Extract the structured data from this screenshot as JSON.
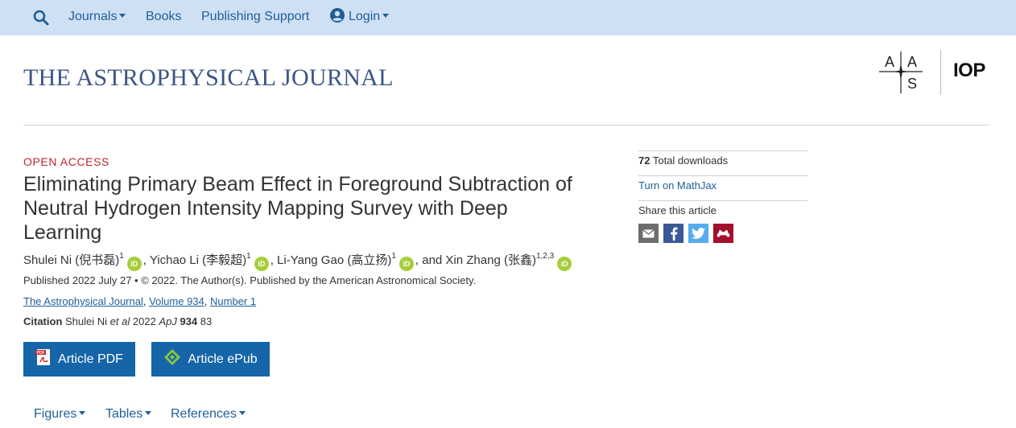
{
  "nav": {
    "journals": "Journals",
    "books": "Books",
    "publishing_support": "Publishing Support",
    "login": "Login"
  },
  "header": {
    "journal_title": "THE ASTROPHYSICAL JOURNAL",
    "aas_letters": [
      "A",
      "A",
      "S"
    ],
    "iop_logo": "IOP"
  },
  "article": {
    "access_label": "OPEN ACCESS",
    "title": "Eliminating Primary Beam Effect in Foreground Subtraction of Neutral Hydrogen Intensity Mapping Survey with Deep Learning",
    "authors": [
      {
        "name": "Shulei Ni (倪书磊)",
        "aff": "1"
      },
      {
        "name": "Yichao Li (李毅超)",
        "aff": "1"
      },
      {
        "name": "Li-Yang Gao (高立扬)",
        "aff": "1"
      },
      {
        "name": "Xin Zhang (张鑫)",
        "aff": "1,2,3"
      }
    ],
    "author_sep": ", ",
    "author_last_sep": ", and ",
    "orcid_label": "iD",
    "published": "Published 2022 July 27 • © 2022. The Author(s). Published by the American Astronomical Society.",
    "journal_link": "The Astrophysical Journal",
    "volume_link": "Volume 934",
    "number_link": "Number 1",
    "link_sep": ", ",
    "citation": {
      "label": "Citation",
      "author": "Shulei Ni",
      "etal": "et al",
      "year": "2022",
      "journal": "ApJ",
      "volume": "934",
      "page": "83"
    },
    "pdf_button": "Article PDF",
    "pdf_badge": "PDF",
    "epub_button": "Article ePub"
  },
  "subnav": {
    "figures": "Figures",
    "tables": "Tables",
    "references": "References"
  },
  "sidebar": {
    "downloads_count": "72",
    "downloads_label": "Total downloads",
    "mathjax": "Turn on MathJax",
    "share_label": "Share this article",
    "share_icons": [
      "email-icon",
      "facebook-icon",
      "twitter-icon",
      "mendeley-icon"
    ]
  },
  "colors": {
    "nav_bg": "#cfe0f5",
    "link": "#1f5f96",
    "title_blue": "#3b5586",
    "open_access_red": "#c0262d",
    "button_blue": "#1565a8",
    "orcid_green": "#a6ce39",
    "email_gray": "#6d6d6d",
    "facebook_blue": "#3b5998",
    "twitter_blue": "#55acee",
    "mendeley_red": "#a3102c"
  }
}
